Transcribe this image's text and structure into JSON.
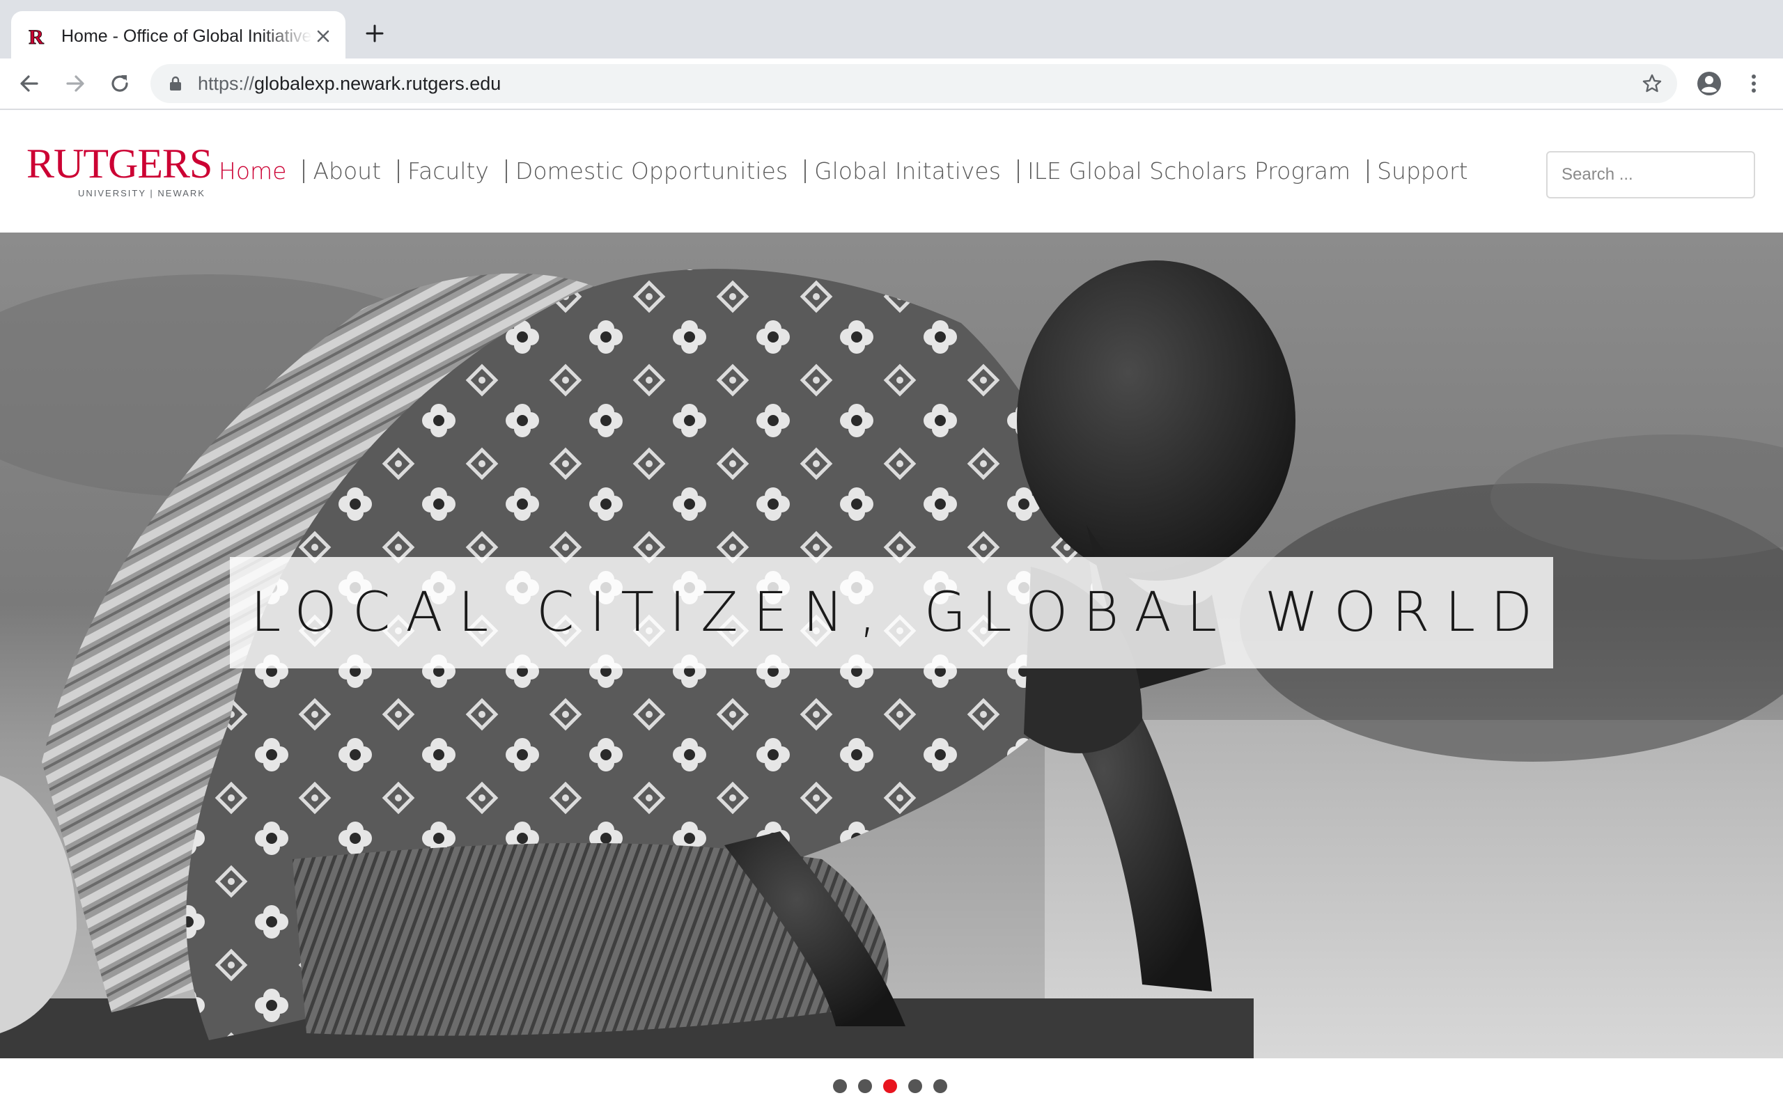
{
  "browser": {
    "tab_title": "Home - Office of Global Initiatives",
    "url_scheme": "https://",
    "url_host": "globalexp.newark.rutgers.edu",
    "icons": {
      "favicon": "rutgers-r-icon",
      "close": "close-icon",
      "new_tab": "plus-icon",
      "back": "back-arrow-icon",
      "forward": "forward-arrow-icon",
      "reload": "reload-icon",
      "lock": "lock-icon",
      "bookmark": "star-icon",
      "profile": "profile-icon",
      "menu": "more-vert-icon"
    }
  },
  "site": {
    "logo_word": "RUTGERS",
    "logo_sub": "UNIVERSITY | NEWARK",
    "accent_color": "#cc0033",
    "nav": [
      {
        "label": "Home",
        "active": true
      },
      {
        "label": "About",
        "active": false
      },
      {
        "label": "Faculty",
        "active": false
      },
      {
        "label": "Domestic Opportunities",
        "active": false
      },
      {
        "label": "Global Initatives",
        "active": false
      },
      {
        "label": "ILE Global Scholars Program",
        "active": false
      },
      {
        "label": "Support",
        "active": false
      }
    ],
    "search_placeholder": "Search ..."
  },
  "hero": {
    "caption": "LOCAL CITIZEN, GLOBAL WORLD",
    "image": "black-and-white photo of a child with a patterned wrap kneeling by the water"
  },
  "carousel": {
    "slide_count": 5,
    "active_index": 2,
    "active_color": "#e8141e"
  }
}
